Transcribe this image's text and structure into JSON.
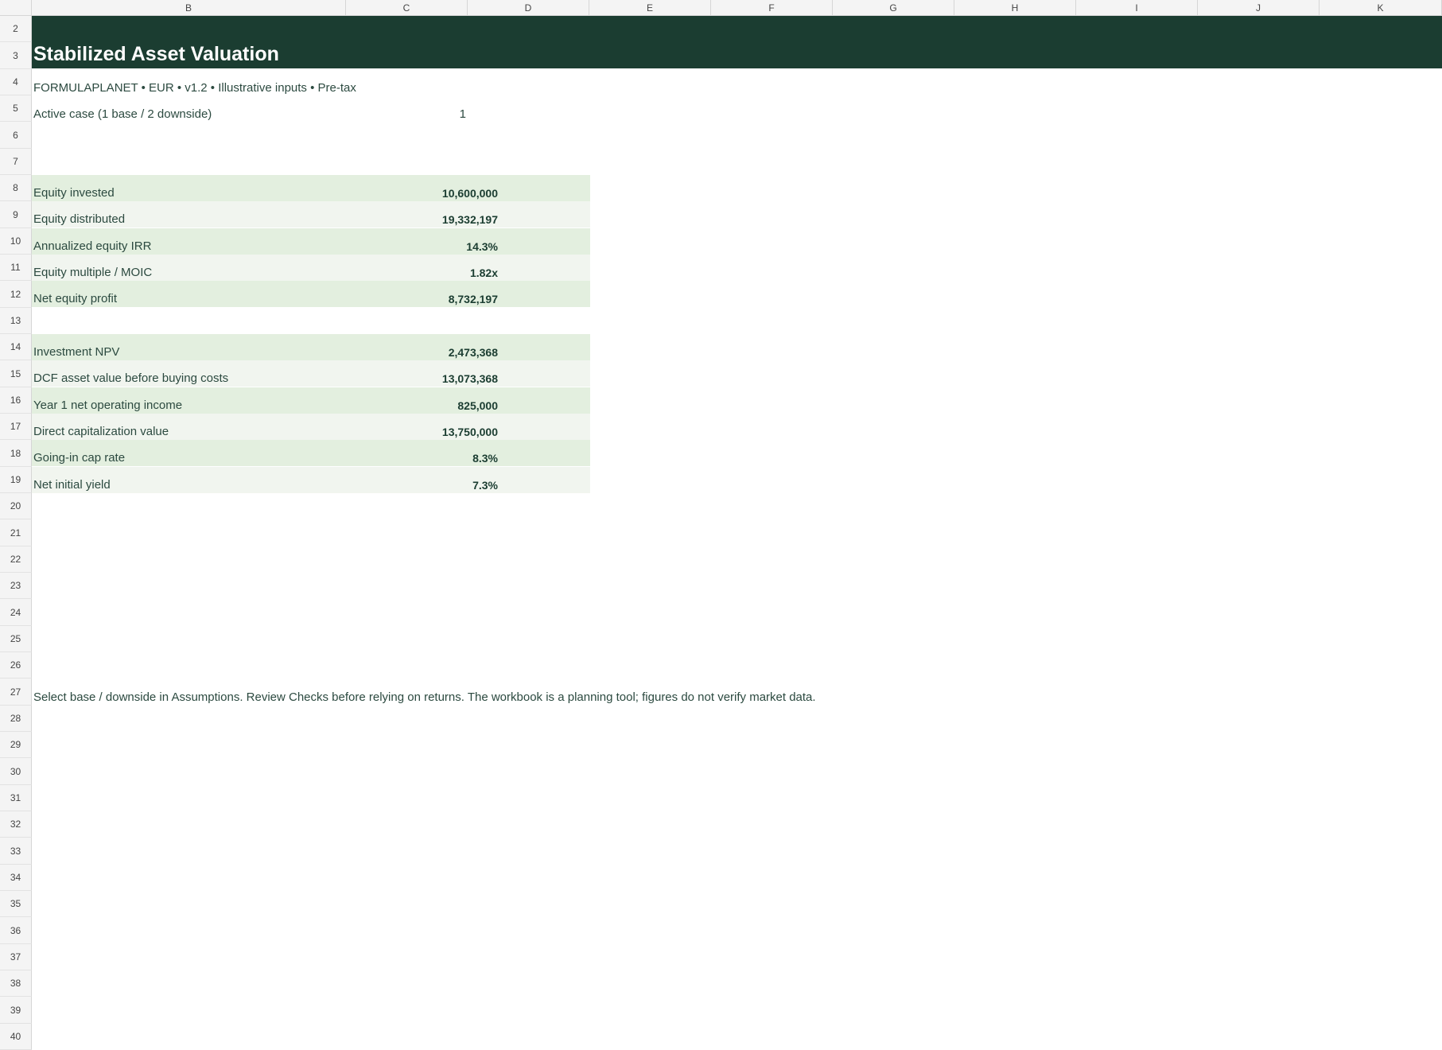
{
  "sheet": {
    "columns": [
      "B",
      "C",
      "D",
      "E",
      "F",
      "G",
      "H",
      "I",
      "J",
      "K"
    ],
    "rows": [
      "2",
      "3",
      "4",
      "5",
      "6",
      "7",
      "8",
      "9",
      "10",
      "11",
      "12",
      "13",
      "14",
      "15",
      "16",
      "17",
      "18",
      "19",
      "20",
      "21",
      "22",
      "23",
      "24",
      "25",
      "26",
      "27",
      "28",
      "29",
      "30",
      "31",
      "32",
      "33",
      "34",
      "35",
      "36",
      "37",
      "38",
      "39",
      "40"
    ]
  },
  "title": "Stabilized Asset Valuation",
  "subtitle": "FORMULAPLANET  •  EUR  •  v1.2  •  Illustrative inputs  •  Pre-tax",
  "active_case": {
    "label": "Active case (1 base / 2 downside)",
    "value": "1"
  },
  "equity_block": [
    {
      "label": "Equity invested",
      "value": "10,600,000"
    },
    {
      "label": "Equity distributed",
      "value": "19,332,197"
    },
    {
      "label": "Annualized equity IRR",
      "value": "14.3%"
    },
    {
      "label": "Equity multiple / MOIC",
      "value": "1.82x"
    },
    {
      "label": "Net equity profit",
      "value": "8,732,197"
    }
  ],
  "valuation_block": [
    {
      "label": "Investment NPV",
      "value": "2,473,368"
    },
    {
      "label": "DCF asset value before buying costs",
      "value": "13,073,368"
    },
    {
      "label": "Year 1 net operating income",
      "value": "825,000"
    },
    {
      "label": "Direct capitalization value",
      "value": "13,750,000"
    },
    {
      "label": "Going-in cap rate",
      "value": "8.3%"
    },
    {
      "label": "Net initial yield",
      "value": "7.3%"
    }
  ],
  "footnote": "Select base / downside in Assumptions. Review Checks before relying on returns. The workbook is a planning tool; figures do not verify market data.",
  "colors": {
    "banner": "#1b3d31",
    "row_band_a": "#e3efdf",
    "row_band_b": "#f1f5ef",
    "text": "#2c4a40"
  }
}
